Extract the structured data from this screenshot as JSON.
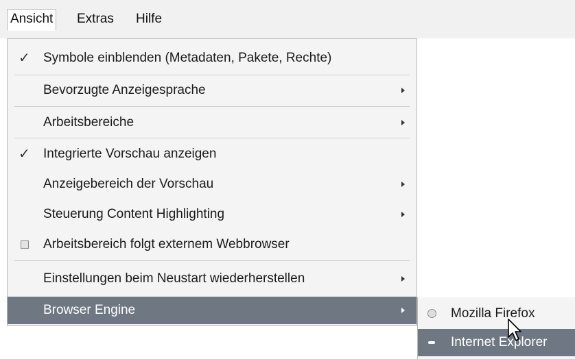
{
  "menubar": {
    "items": [
      "Ansicht",
      "Extras",
      "Hilfe"
    ],
    "active": "Ansicht"
  },
  "menu": {
    "items": [
      {
        "label": "Symbole einblenden (Metadaten, Pakete, Rechte)",
        "state": "checked"
      },
      {
        "label": "Bevorzugte Anzeigesprache",
        "submenu": true
      },
      {
        "label": "Arbeitsbereiche",
        "submenu": true
      },
      {
        "label": "Integrierte Vorschau anzeigen",
        "state": "checked"
      },
      {
        "label": "Anzeigebereich der Vorschau",
        "submenu": true
      },
      {
        "label": "Steuerung Content Highlighting",
        "submenu": true
      },
      {
        "label": "Arbeitsbereich folgt externem Webbrowser",
        "state": "checkbox-unchecked"
      },
      {
        "label": "Einstellungen beim Neustart wiederherstellen",
        "submenu": true
      },
      {
        "label": "Browser Engine",
        "submenu": true,
        "highlighted": true
      }
    ]
  },
  "submenu": {
    "items": [
      {
        "label": "Mozilla Firefox",
        "selected": false
      },
      {
        "label": "Internet Explorer",
        "selected": true,
        "highlighted": true
      }
    ]
  },
  "colors": {
    "highlight": "#6e7782",
    "menu_bg": "#f4f4f4",
    "menubar_bg": "#f1f1f1"
  }
}
